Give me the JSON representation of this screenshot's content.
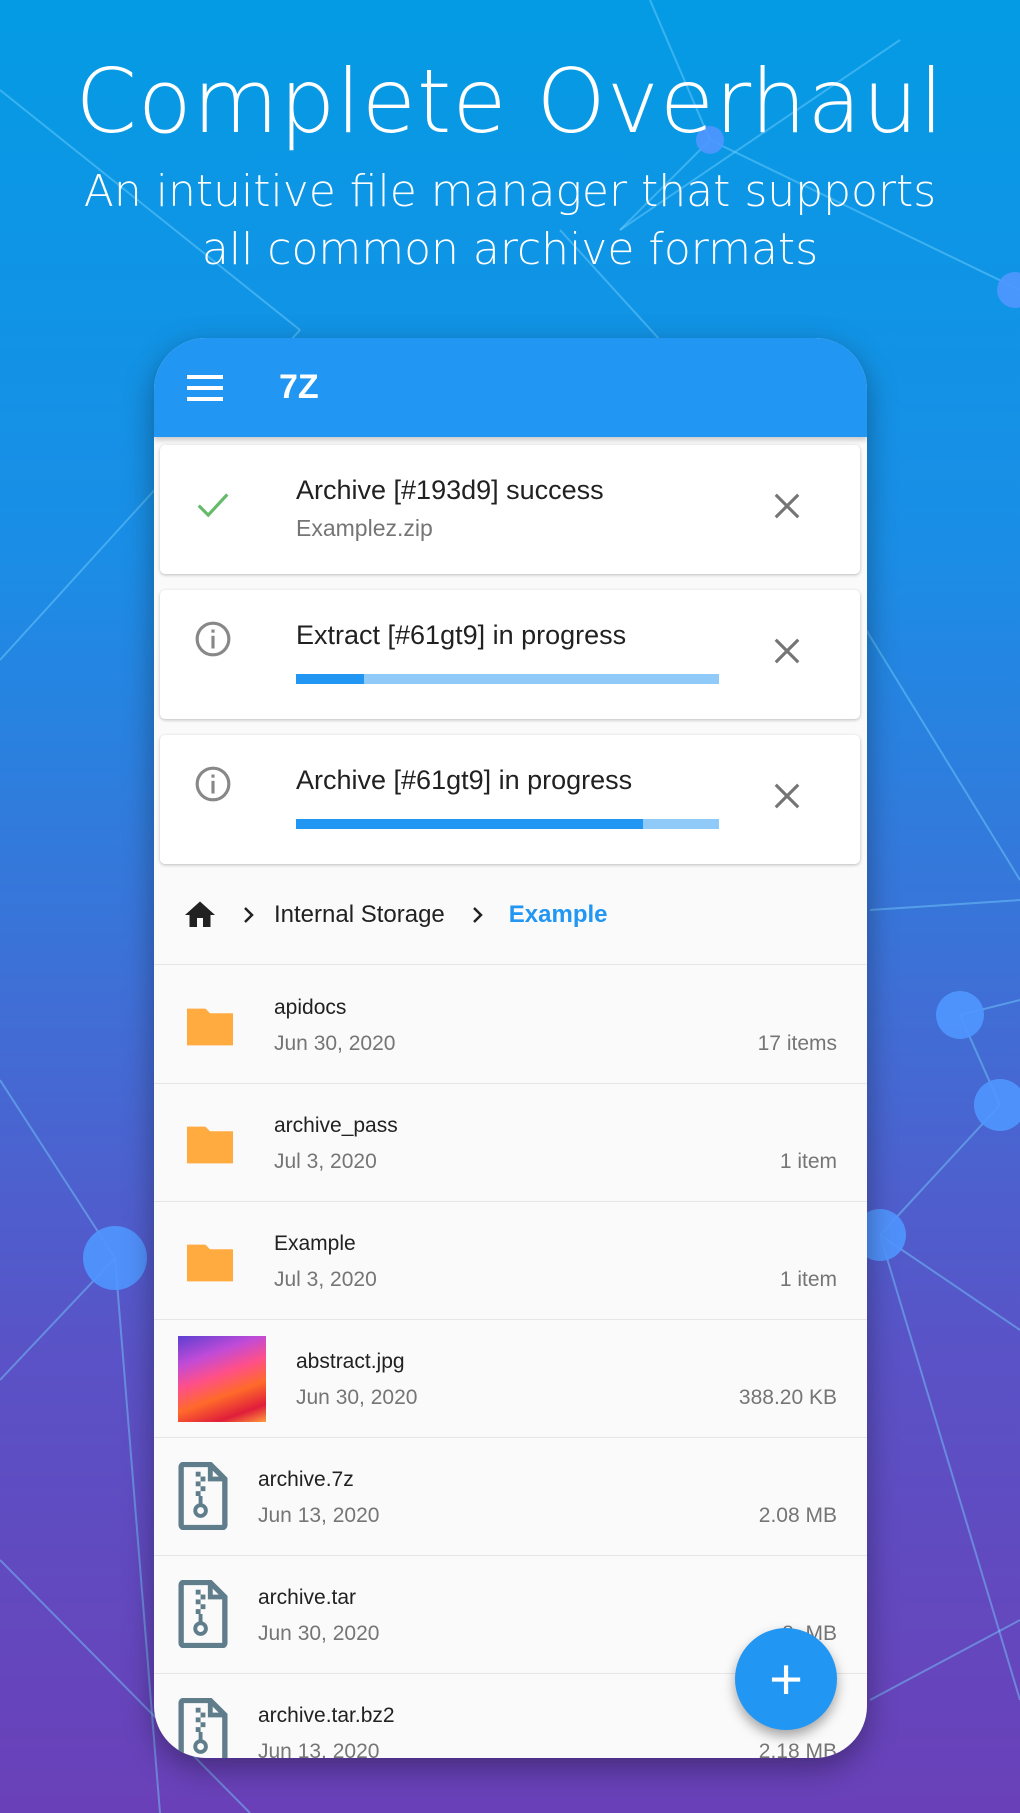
{
  "hero": {
    "title": "Complete Overhaul",
    "subtitle_line1": "An intuitive file manager that supports",
    "subtitle_line2": "all common archive formats"
  },
  "app": {
    "title": "7Z",
    "accent": "#2196f3"
  },
  "notifications": [
    {
      "icon": "check-icon",
      "title": "Archive [#193d9] success",
      "subtitle": "Examplez.zip"
    },
    {
      "icon": "info-icon",
      "title": "Extract [#61gt9] in progress",
      "progress": 0.16
    },
    {
      "icon": "info-icon",
      "title": "Archive [#61gt9] in progress",
      "progress": 0.82
    }
  ],
  "breadcrumb": {
    "items": [
      "Internal Storage"
    ],
    "current": "Example"
  },
  "files": [
    {
      "type": "folder",
      "name": "apidocs",
      "date": "Jun 30, 2020",
      "size": "17 items"
    },
    {
      "type": "folder",
      "name": "archive_pass",
      "date": "Jul 3, 2020",
      "size": "1 item"
    },
    {
      "type": "folder",
      "name": "Example",
      "date": "Jul 3, 2020",
      "size": "1 item"
    },
    {
      "type": "image",
      "name": "abstract.jpg",
      "date": "Jun 30, 2020",
      "size": "388.20 KB"
    },
    {
      "type": "archive",
      "name": "archive.7z",
      "date": "Jun 13, 2020",
      "size": "2.08 MB"
    },
    {
      "type": "archive",
      "name": "archive.tar",
      "date": "Jun 30, 2020",
      "size": "8.   MB"
    },
    {
      "type": "archive",
      "name": "archive.tar.bz2",
      "date": "Jun 13, 2020",
      "size": "2.18 MB"
    }
  ],
  "fab": {
    "label": "+"
  }
}
